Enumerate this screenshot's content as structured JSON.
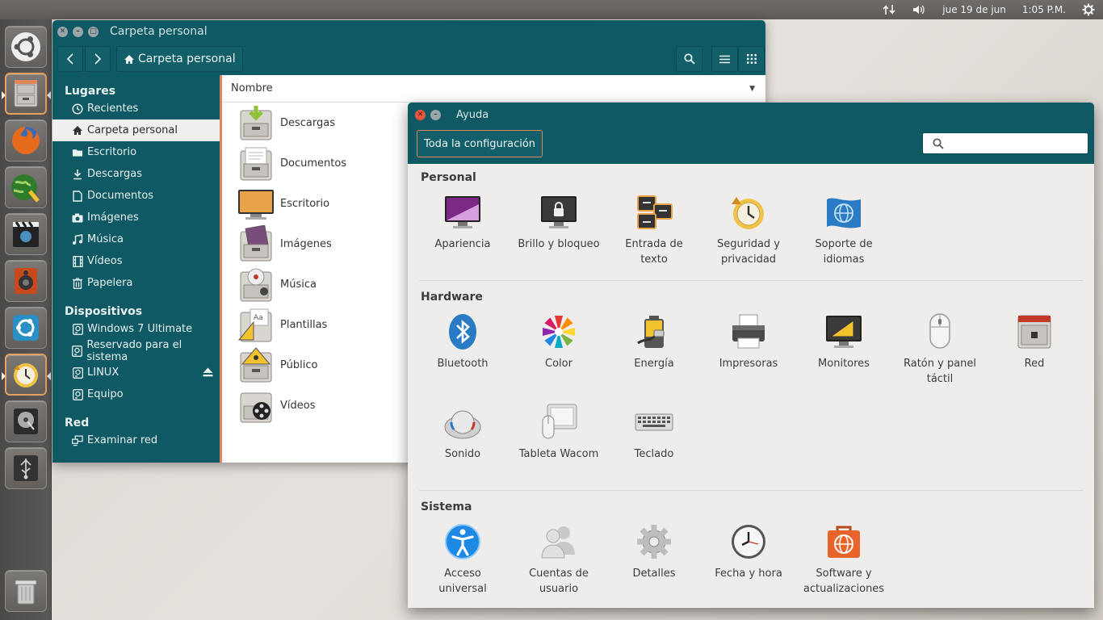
{
  "top_panel": {
    "date": "jue 19 de jun",
    "time": "1:05 P.M."
  },
  "file_manager": {
    "title": "Carpeta personal",
    "breadcrumb": "Carpeta personal",
    "column": "Nombre",
    "sidebar": {
      "places_header": "Lugares",
      "places": [
        "Recientes",
        "Carpeta personal",
        "Escritorio",
        "Descargas",
        "Documentos",
        "Imágenes",
        "Música",
        "Vídeos",
        "Papelera"
      ],
      "devices_header": "Dispositivos",
      "devices": [
        "Windows 7 Ultimate",
        "Reservado para el sistema",
        "LINUX",
        "Equipo"
      ],
      "network_header": "Red",
      "network": [
        "Examinar red"
      ]
    },
    "files": [
      "Descargas",
      "Documentos",
      "Escritorio",
      "Imágenes",
      "Música",
      "Plantillas",
      "Público",
      "Vídeos"
    ]
  },
  "settings": {
    "title": "Ayuda",
    "all_settings": "Toda la configuración",
    "sections": {
      "personal": "Personal",
      "hardware": "Hardware",
      "system": "Sistema"
    },
    "personal_items": [
      [
        "Apariencia",
        ""
      ],
      [
        "Brillo y bloqueo",
        ""
      ],
      [
        "Entrada de",
        "texto"
      ],
      [
        "Seguridad y",
        "privacidad"
      ],
      [
        "Soporte de",
        "idiomas"
      ]
    ],
    "hardware_items": [
      [
        "Bluetooth",
        ""
      ],
      [
        "Color",
        ""
      ],
      [
        "Energía",
        ""
      ],
      [
        "Impresoras",
        ""
      ],
      [
        "Monitores",
        ""
      ],
      [
        "Ratón y panel",
        "táctil"
      ],
      [
        "Red",
        ""
      ],
      [
        "Sonido",
        ""
      ],
      [
        "Tableta Wacom",
        ""
      ],
      [
        "Teclado",
        ""
      ]
    ],
    "system_items": [
      [
        "Acceso",
        "universal"
      ],
      [
        "Cuentas de",
        "usuario"
      ],
      [
        "Detalles",
        ""
      ],
      [
        "Fecha y hora",
        ""
      ],
      [
        "Software y",
        "actualizaciones"
      ]
    ]
  },
  "colors": {
    "teal": "#0e5964",
    "accent": "#e0865a",
    "panel": "#5d5a57"
  }
}
